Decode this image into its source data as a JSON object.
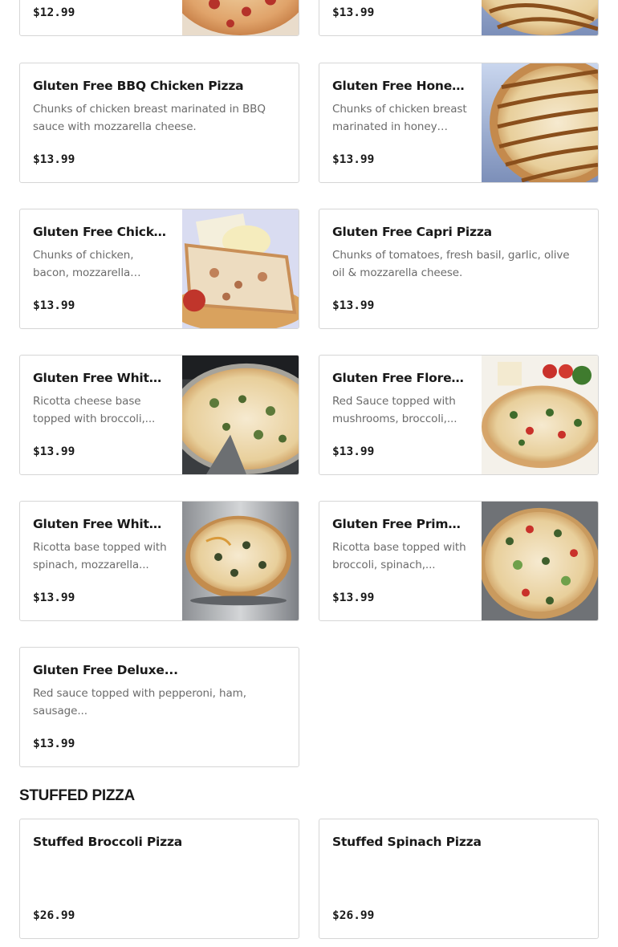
{
  "top_row": [
    {
      "price": "$12.99",
      "image": "pizza-photo"
    },
    {
      "price": "$13.99",
      "image": "pizza-photo"
    }
  ],
  "gluten_free": [
    {
      "name": "Gluten Free BBQ Chicken Pizza",
      "description": "Chunks of chicken breast marinated in BBQ sauce with mozzarella cheese.",
      "price": "$13.99"
    },
    {
      "name": "Gluten Free Honey...",
      "description": "Chunks of chicken breast marinated in honey BBQ...",
      "price": "$13.99",
      "image": "honey-bbq-pizza-photo"
    },
    {
      "name": "Gluten Free Chicken...",
      "description": "Chunks of chicken, bacon, mozzarella cheese & ran...",
      "price": "$13.99",
      "image": "chicken-bacon-pizza-photo"
    },
    {
      "name": "Gluten Free Capri Pizza",
      "description": "Chunks of tomatoes, fresh basil, garlic, olive oil & mozzarella cheese.",
      "price": "$13.99"
    },
    {
      "name": "Gluten Free White...",
      "description": "Ricotta cheese base topped with broccoli,...",
      "price": "$13.99",
      "image": "white-broccoli-pizza-photo"
    },
    {
      "name": "Gluten Free Florentin...",
      "description": "Red Sauce topped with mushrooms, broccoli,...",
      "price": "$13.99",
      "image": "florentine-pizza-photo"
    },
    {
      "name": "Gluten Free White...",
      "description": "Ricotta base topped with spinach, mozzarella...",
      "price": "$13.99",
      "image": "white-spinach-pizza-photo"
    },
    {
      "name": "Gluten Free Primaver...",
      "description": "Ricotta base topped with broccoli, spinach,...",
      "price": "$13.99",
      "image": "primavera-pizza-photo"
    },
    {
      "name": "Gluten Free Deluxe...",
      "description": "Red sauce topped with pepperoni, ham, sausage...",
      "price": "$13.99"
    }
  ],
  "stuffed_section": {
    "title": "STUFFED PIZZA",
    "items": [
      {
        "name": "Stuffed Broccoli Pizza",
        "description": "",
        "price": "$26.99"
      },
      {
        "name": "Stuffed Spinach Pizza",
        "description": "",
        "price": "$26.99"
      }
    ]
  }
}
